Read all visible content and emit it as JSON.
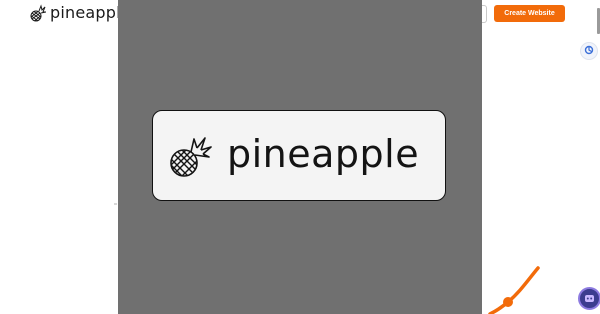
{
  "header": {
    "logo_text": "pineapple",
    "cta_label": "Create Website"
  },
  "modal": {
    "logo_text": "pineapple"
  },
  "colors": {
    "brand_orange": "#f26b0a",
    "overlay_gray": "#707070",
    "card_background": "#f4f4f4",
    "chat_widget": "#3c3c8f"
  },
  "icons": {
    "logo": "pineapple-icon",
    "translate": "translate-icon",
    "chat": "chat-bot-icon"
  }
}
